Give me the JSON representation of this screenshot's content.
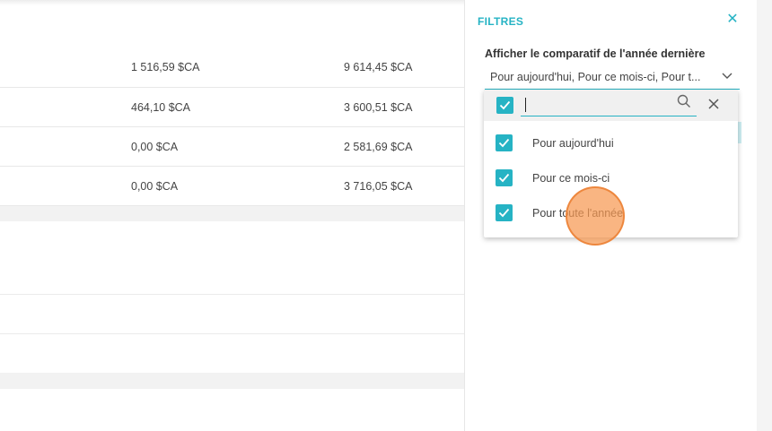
{
  "table": {
    "rows": [
      {
        "c1": "1 516,59 $CA",
        "c2": "9 614,45 $CA"
      },
      {
        "c1": "464,10 $CA",
        "c2": "3 600,51 $CA"
      },
      {
        "c1": "0,00 $CA",
        "c2": "2 581,69 $CA"
      },
      {
        "c1": "0,00 $CA",
        "c2": "3 716,05 $CA"
      }
    ]
  },
  "filters": {
    "title": "FILTRES",
    "close_icon": "close-icon",
    "field_label": "Afficher le comparatif de l'année dernière",
    "select_value": "Pour aujourd'hui, Pour ce mois-ci, Pour t...",
    "chevron_icon": "chevron-down-icon",
    "accent_color": "#26b3c4"
  },
  "dropdown": {
    "select_all_checked": true,
    "search_value": "",
    "search_icon": "search-icon",
    "clear_icon": "close-icon",
    "options": [
      {
        "label": "Pour aujourd'hui",
        "checked": true
      },
      {
        "label": "Pour ce mois-ci",
        "checked": true
      },
      {
        "label": "Pour toute l'année",
        "checked": true
      }
    ]
  }
}
